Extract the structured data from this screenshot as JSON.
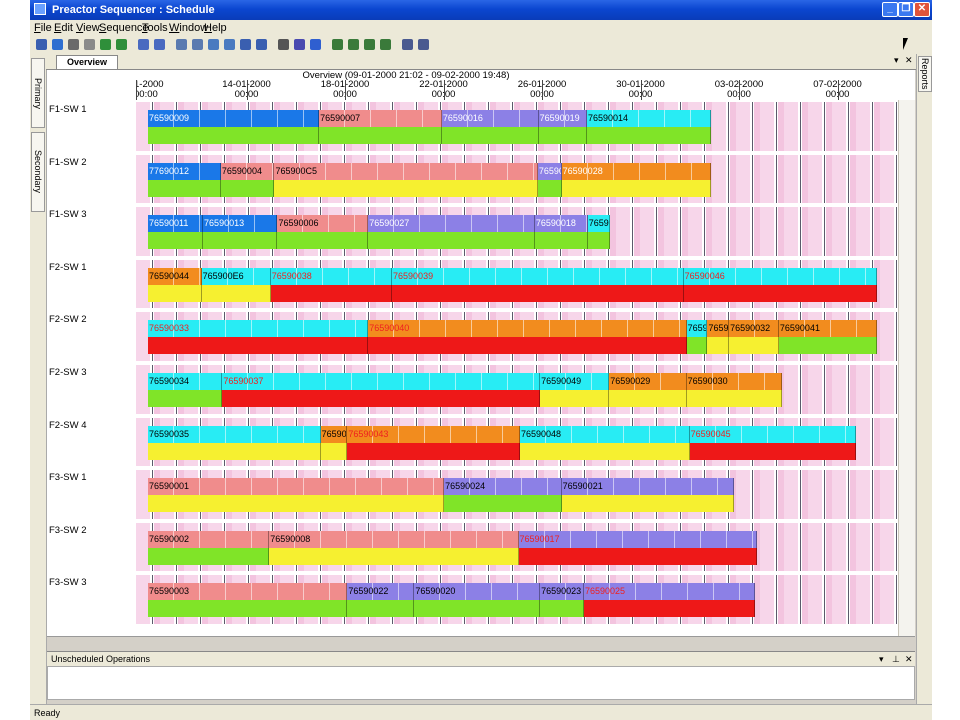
{
  "window": {
    "title": "Preactor Sequencer : Schedule"
  },
  "menu": [
    "File",
    "Edit",
    "View",
    "Sequence",
    "Tools",
    "Window",
    "Help"
  ],
  "toolbar_icons": [
    "new-icon",
    "save-icon",
    "print-icon",
    "preview-icon",
    "globe-icon",
    "check-icon",
    "undo-icon",
    "redo-icon",
    "grid-icon",
    "grid2-icon",
    "chart-icon",
    "chart2-icon",
    "sequence-icon",
    "sequence2-icon",
    "find-icon",
    "options-icon",
    "help-icon",
    "zoom-in-icon",
    "zoom-out-icon",
    "zoom-fit-icon",
    "zoom-reset-icon",
    "layout-icon",
    "layout2-icon"
  ],
  "side_tabs": {
    "primary": "Primary Calendars",
    "secondary": "Secondary Calendars",
    "reports": "Reports"
  },
  "document_tab": "Overview",
  "schedule": {
    "header": "Overview   (09-01-2000 21:02 - 09-02-2000 19:48)",
    "dates": [
      {
        "date": "1-2000",
        "time": "00:00"
      },
      {
        "date": "14-01-2000",
        "time": "00:00"
      },
      {
        "date": "18-01-2000",
        "time": "00:00"
      },
      {
        "date": "22-01-2000",
        "time": "00:00"
      },
      {
        "date": "26-01-2000",
        "time": "00:00"
      },
      {
        "date": "30-01-2000",
        "time": "00:00"
      },
      {
        "date": "03-02-2000",
        "time": "00:00"
      },
      {
        "date": "07-02-2000",
        "time": "00:00"
      }
    ],
    "resources": [
      "F1-SW 1",
      "F1-SW 2",
      "F1-SW 3",
      "F2-SW 1",
      "F2-SW 2",
      "F2-SW 3",
      "F2-SW 4",
      "F3-SW 1",
      "F3-SW 2",
      "F3-SW 3"
    ],
    "colors": {
      "blue": "#1a78e8",
      "salmon": "#f08c8c",
      "purple": "#8c80e6",
      "cyan": "#28ecf4",
      "orange": "#f28c1e",
      "green": "#80e428",
      "yellow": "#f6f030",
      "red": "#ee1818"
    },
    "rows": [
      {
        "bars": [
          {
            "label": "76590009",
            "start": 0.0,
            "end": 0.23,
            "top": "blue",
            "bottom": "green",
            "label_color": "#ffffff"
          },
          {
            "label": "76590007",
            "start": 0.23,
            "end": 0.395,
            "top": "salmon",
            "bottom": "green",
            "label_color": "#000000"
          },
          {
            "label": "76590016",
            "start": 0.395,
            "end": 0.525,
            "top": "purple",
            "bottom": "green",
            "label_color": "#ffffff"
          },
          {
            "label": "76590019",
            "start": 0.525,
            "end": 0.59,
            "top": "purple",
            "bottom": "green",
            "label_color": "#ffffff"
          },
          {
            "label": "76590014",
            "start": 0.59,
            "end": 0.757,
            "top": "cyan",
            "bottom": "green",
            "label_color": "#000000"
          }
        ]
      },
      {
        "bars": [
          {
            "label": "77690012",
            "start": 0.0,
            "end": 0.098,
            "top": "blue",
            "bottom": "green",
            "label_color": "#ffffff"
          },
          {
            "label": "76590004",
            "start": 0.098,
            "end": 0.17,
            "top": "salmon",
            "bottom": "green",
            "label_color": "#000000"
          },
          {
            "label": "765900C5",
            "start": 0.17,
            "end": 0.524,
            "top": "salmon",
            "bottom": "yellow",
            "label_color": "#000000"
          },
          {
            "label": "76590",
            "start": 0.524,
            "end": 0.556,
            "top": "purple",
            "bottom": "green",
            "label_color": "#ffffff"
          },
          {
            "label": "76590028",
            "start": 0.556,
            "end": 0.757,
            "top": "orange",
            "bottom": "yellow",
            "label_color": "#ffffff"
          }
        ]
      },
      {
        "bars": [
          {
            "label": "76590011",
            "start": 0.0,
            "end": 0.074,
            "top": "blue",
            "bottom": "green",
            "label_color": "#ffffff"
          },
          {
            "label": "76590013",
            "start": 0.074,
            "end": 0.174,
            "top": "blue",
            "bottom": "green",
            "label_color": "#ffffff"
          },
          {
            "label": "76590006",
            "start": 0.174,
            "end": 0.296,
            "top": "salmon",
            "bottom": "green",
            "label_color": "#000000"
          },
          {
            "label": "76590027",
            "start": 0.296,
            "end": 0.52,
            "top": "purple",
            "bottom": "green",
            "label_color": "#ffffff"
          },
          {
            "label": "76590018",
            "start": 0.52,
            "end": 0.591,
            "top": "purple",
            "bottom": "green",
            "label_color": "#ffffff"
          },
          {
            "label": "7659",
            "start": 0.591,
            "end": 0.621,
            "top": "cyan",
            "bottom": "green",
            "label_color": "#000000"
          }
        ]
      },
      {
        "bars": [
          {
            "label": "76590044",
            "start": 0.0,
            "end": 0.072,
            "top": "orange",
            "bottom": "yellow",
            "label_color": "#000000"
          },
          {
            "label": "765900E6",
            "start": 0.072,
            "end": 0.165,
            "top": "cyan",
            "bottom": "yellow",
            "label_color": "#000000"
          },
          {
            "label": "76590038",
            "start": 0.165,
            "end": 0.328,
            "top": "cyan",
            "bottom": "red",
            "label_color": "#ee2020"
          },
          {
            "label": "76590039",
            "start": 0.328,
            "end": 0.72,
            "top": "cyan",
            "bottom": "red",
            "label_color": "#ee2020"
          },
          {
            "label": "76590046",
            "start": 0.72,
            "end": 0.98,
            "top": "cyan",
            "bottom": "red",
            "label_color": "#ee2020"
          }
        ]
      },
      {
        "bars": [
          {
            "label": "76590033",
            "start": 0.0,
            "end": 0.296,
            "top": "cyan",
            "bottom": "red",
            "label_color": "#ee2020"
          },
          {
            "label": "76590040",
            "start": 0.296,
            "end": 0.724,
            "top": "orange",
            "bottom": "red",
            "label_color": "#ee2020"
          },
          {
            "label": "7659",
            "start": 0.724,
            "end": 0.752,
            "top": "cyan",
            "bottom": "green",
            "label_color": "#000000"
          },
          {
            "label": "7659",
            "start": 0.752,
            "end": 0.781,
            "top": "orange",
            "bottom": "yellow",
            "label_color": "#000000"
          },
          {
            "label": "76590032",
            "start": 0.781,
            "end": 0.848,
            "top": "orange",
            "bottom": "yellow",
            "label_color": "#000000"
          },
          {
            "label": "76590041",
            "start": 0.848,
            "end": 0.98,
            "top": "orange",
            "bottom": "green",
            "label_color": "#000000"
          }
        ]
      },
      {
        "bars": [
          {
            "label": "76590034",
            "start": 0.0,
            "end": 0.1,
            "top": "cyan",
            "bottom": "green",
            "label_color": "#000000"
          },
          {
            "label": "76590037",
            "start": 0.1,
            "end": 0.527,
            "top": "cyan",
            "bottom": "red",
            "label_color": "#ee2020"
          },
          {
            "label": "76590049",
            "start": 0.527,
            "end": 0.62,
            "top": "cyan",
            "bottom": "yellow",
            "label_color": "#000000"
          },
          {
            "label": "76590029",
            "start": 0.62,
            "end": 0.724,
            "top": "orange",
            "bottom": "yellow",
            "label_color": "#000000"
          },
          {
            "label": "76590030",
            "start": 0.724,
            "end": 0.852,
            "top": "orange",
            "bottom": "yellow",
            "label_color": "#000000"
          }
        ]
      },
      {
        "bars": [
          {
            "label": "76590035",
            "start": 0.0,
            "end": 0.232,
            "top": "cyan",
            "bottom": "yellow",
            "label_color": "#000000"
          },
          {
            "label": "76590",
            "start": 0.232,
            "end": 0.268,
            "top": "orange",
            "bottom": "yellow",
            "label_color": "#000000"
          },
          {
            "label": "76590043",
            "start": 0.268,
            "end": 0.5,
            "top": "orange",
            "bottom": "red",
            "label_color": "#ee2020"
          },
          {
            "label": "76590048",
            "start": 0.5,
            "end": 0.728,
            "top": "cyan",
            "bottom": "yellow",
            "label_color": "#000000"
          },
          {
            "label": "76590045",
            "start": 0.728,
            "end": 0.951,
            "top": "cyan",
            "bottom": "red",
            "label_color": "#ee2020"
          }
        ]
      },
      {
        "bars": [
          {
            "label": "76590001",
            "start": 0.0,
            "end": 0.398,
            "top": "salmon",
            "bottom": "yellow",
            "label_color": "#000000"
          },
          {
            "label": "76590024",
            "start": 0.398,
            "end": 0.556,
            "top": "purple",
            "bottom": "green",
            "label_color": "#000000"
          },
          {
            "label": "76590021",
            "start": 0.556,
            "end": 0.787,
            "top": "purple",
            "bottom": "yellow",
            "label_color": "#000000"
          }
        ]
      },
      {
        "bars": [
          {
            "label": "76590002",
            "start": 0.0,
            "end": 0.163,
            "top": "salmon",
            "bottom": "green",
            "label_color": "#000000"
          },
          {
            "label": "76590008",
            "start": 0.163,
            "end": 0.498,
            "top": "salmon",
            "bottom": "yellow",
            "label_color": "#000000"
          },
          {
            "label": "76590017",
            "start": 0.498,
            "end": 0.819,
            "top": "purple",
            "bottom": "red",
            "label_color": "#ee2020"
          }
        ]
      },
      {
        "bars": [
          {
            "label": "76590003",
            "start": 0.0,
            "end": 0.268,
            "top": "salmon",
            "bottom": "green",
            "label_color": "#000000"
          },
          {
            "label": "76590022",
            "start": 0.268,
            "end": 0.358,
            "top": "purple",
            "bottom": "green",
            "label_color": "#000000"
          },
          {
            "label": "76590020",
            "start": 0.358,
            "end": 0.527,
            "top": "purple",
            "bottom": "green",
            "label_color": "#000000"
          },
          {
            "label": "76590023",
            "start": 0.527,
            "end": 0.586,
            "top": "purple",
            "bottom": "green",
            "label_color": "#000000"
          },
          {
            "label": "76590025",
            "start": 0.586,
            "end": 0.816,
            "top": "purple",
            "bottom": "red",
            "label_color": "#ee2020"
          }
        ]
      }
    ]
  },
  "unscheduled": {
    "title": "Unscheduled Operations"
  },
  "status": {
    "text": "Ready"
  }
}
